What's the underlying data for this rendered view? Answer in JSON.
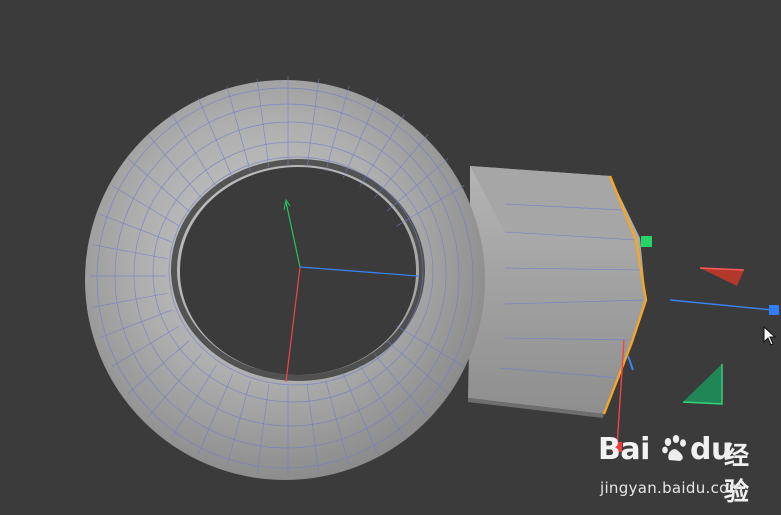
{
  "viewport": {
    "background": "#3b3b3b",
    "object": "torus-with-extruded-tab",
    "selection_color": "#f5a623",
    "axis_colors": {
      "x": "#3b82f6",
      "y": "#ef4444",
      "z": "#22c55e"
    }
  },
  "watermark": {
    "brand_prefix": "Bai",
    "brand_suffix": "du",
    "brand_cn": "经验",
    "url": "jingyan.baidu.com"
  },
  "icons": [
    "move-gizmo-icon",
    "cursor-icon",
    "baidu-paw-icon"
  ]
}
